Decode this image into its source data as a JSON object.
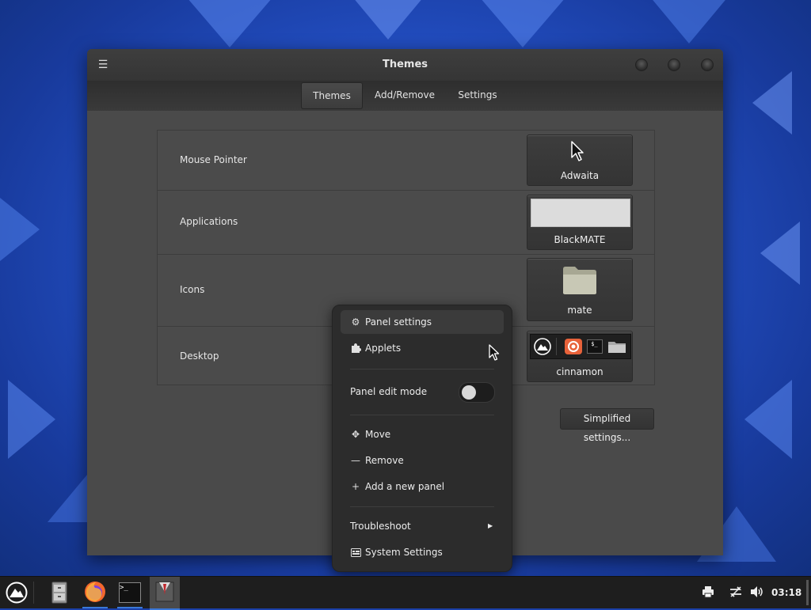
{
  "window": {
    "title": "Themes",
    "menu_icon": "hamburger-icon"
  },
  "tabs": [
    {
      "label": "Themes",
      "active": true
    },
    {
      "label": "Add/Remove",
      "active": false
    },
    {
      "label": "Settings",
      "active": false
    }
  ],
  "themes": [
    {
      "category": "Mouse Pointer",
      "value": "Adwaita",
      "preview": "pointer-arrow-icon"
    },
    {
      "category": "Applications",
      "value": "BlackMATE",
      "preview": "light-gray-swatch"
    },
    {
      "category": "Icons",
      "value": "mate",
      "preview": "folder-icon"
    },
    {
      "category": "Desktop",
      "value": "cinnamon",
      "preview": "panel-preview"
    }
  ],
  "simplified_button": "Simplified settings...",
  "context_menu": {
    "panel_settings": "Panel settings",
    "applets": "Applets",
    "panel_edit_mode": "Panel edit mode",
    "panel_edit_mode_on": false,
    "move": "Move",
    "remove": "Remove",
    "add_new_panel": "Add a new panel",
    "troubleshoot": "Troubleshoot",
    "system_settings": "System Settings"
  },
  "taskbar": {
    "launchers": [
      "menu-icon",
      "file-manager-icon",
      "firefox-icon",
      "terminal-icon",
      "themes-app-icon"
    ],
    "tray": [
      "printer-icon",
      "network-icon",
      "volume-icon"
    ],
    "clock": "03:18"
  },
  "colors": {
    "accent": "#3a78d8",
    "window_bg": "#4a4a4a",
    "menu_bg": "#2c2c2c"
  }
}
